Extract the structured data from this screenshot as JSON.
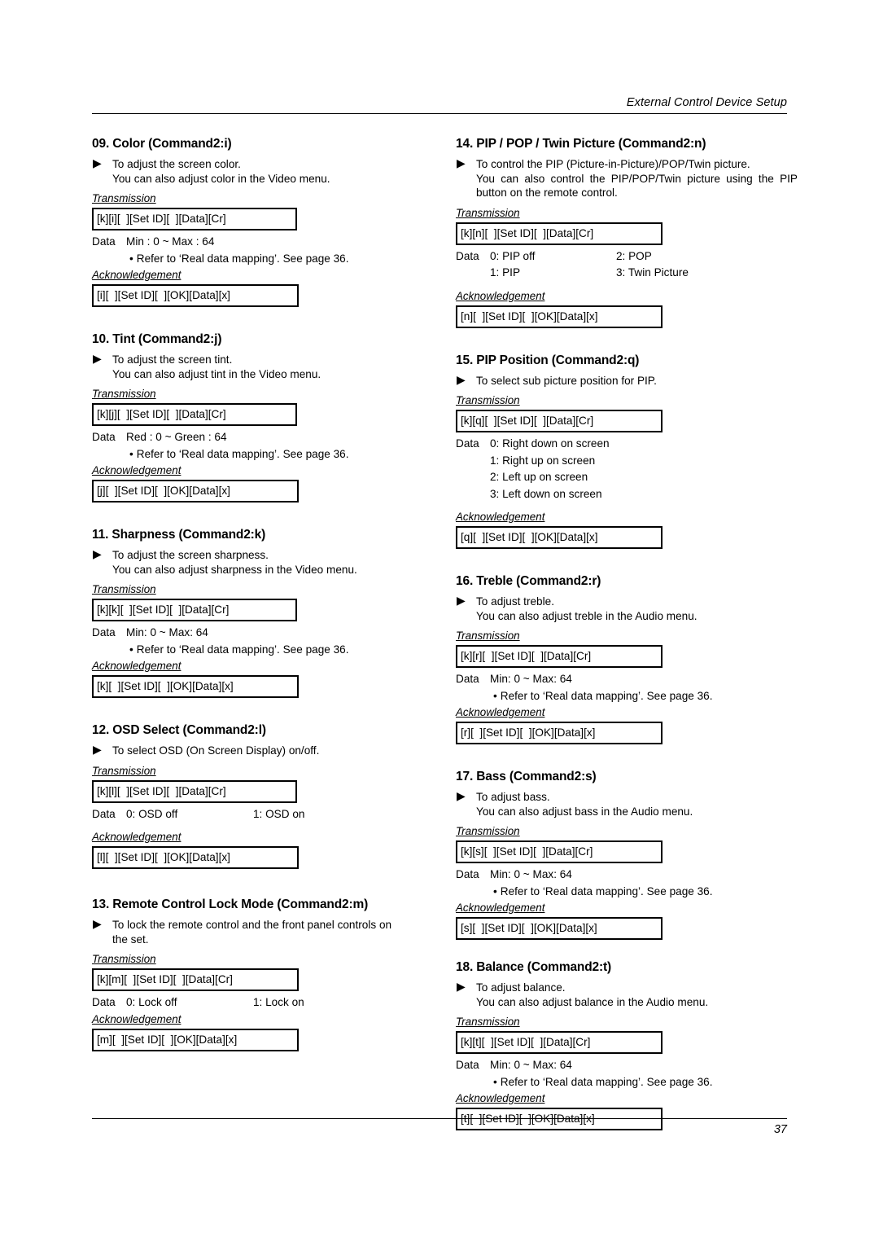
{
  "header": {
    "title": "External Control Device Setup"
  },
  "footer": {
    "page_number": "37"
  },
  "labels": {
    "transmission": "Transmission",
    "acknowledgement": "Acknowledgement",
    "data": "Data",
    "triangle": "▶",
    "bullet": "•"
  },
  "sections": {
    "s09": {
      "title": "09. Color (Command2:i)",
      "desc1": "To adjust the screen color.",
      "desc2": "You can also adjust color in the Video menu.",
      "transmission": "[k][i][  ][Set ID][  ][Data][Cr]",
      "data_key": "Data",
      "data_value": "Min : 0 ~ Max : 64",
      "refer": "Refer to ‘Real data mapping’. See page 36.",
      "acknowledgement": "[i][  ][Set ID][  ][OK][Data][x]"
    },
    "s10": {
      "title": "10. Tint (Command2:j)",
      "desc1": "To adjust the screen tint.",
      "desc2": "You can also adjust tint in the Video menu.",
      "transmission": "[k][j][  ][Set ID][  ][Data][Cr]",
      "data_key": "Data",
      "data_value": "Red : 0 ~ Green : 64",
      "refer": "Refer to ‘Real data mapping’. See page 36.",
      "acknowledgement": "[j][  ][Set ID][  ][OK][Data][x]"
    },
    "s11": {
      "title": "11. Sharpness (Command2:k)",
      "desc1": "To adjust the screen sharpness.",
      "desc2": "You can also adjust sharpness in the Video menu.",
      "transmission": "[k][k][  ][Set ID][  ][Data][Cr]",
      "data_key": "Data",
      "data_value": "Min: 0 ~ Max: 64",
      "refer": "Refer to ‘Real data mapping’. See page 36.",
      "acknowledgement": "[k][  ][Set ID][  ][OK][Data][x]"
    },
    "s12": {
      "title": "12. OSD Select (Command2:l)",
      "desc1": "To select OSD (On Screen Display) on/off.",
      "transmission": "[k][l][  ][Set ID][  ][Data][Cr]",
      "data_key": "Data",
      "data_value": "0: OSD off",
      "data_value2": "1: OSD on",
      "acknowledgement": "[l][  ][Set ID][  ][OK][Data][x]"
    },
    "s13": {
      "title": "13. Remote Control Lock Mode (Command2:m)",
      "desc1": "To lock the remote control and the front panel controls on",
      "desc2": "the set.",
      "transmission": "[k][m][  ][Set ID][  ][Data][Cr]",
      "data_key": "Data",
      "data_value": "0: Lock off",
      "data_value2": "1: Lock on",
      "acknowledgement": "[m][  ][Set ID][  ][OK][Data][x]"
    },
    "s14": {
      "title": "14. PIP / POP / Twin Picture (Command2:n)",
      "desc1": "To control the PIP (Picture-in-Picture)/POP/Twin picture.",
      "desc2": "You can also control the PIP/POP/Twin picture using the PIP button on the remote control.",
      "transmission": "[k][n][  ][Set ID][  ][Data][Cr]",
      "data_key": "Data",
      "data_value": "0: PIP off",
      "data_value2": "2: POP",
      "data_value3": "1: PIP",
      "data_value4": "3: Twin Picture",
      "acknowledgement": "[n][  ][Set ID][  ][OK][Data][x]"
    },
    "s15": {
      "title": "15. PIP Position (Command2:q)",
      "desc1": "To select sub picture position for PIP.",
      "transmission": "[k][q][  ][Set ID][  ][Data][Cr]",
      "data_key": "Data",
      "data_value": "0: Right down on screen",
      "data_value2": "1: Right up on screen",
      "data_value3": "2: Left up on screen",
      "data_value4": "3: Left down on screen",
      "acknowledgement": "[q][  ][Set ID][  ][OK][Data][x]"
    },
    "s16": {
      "title": "16. Treble (Command2:r)",
      "desc1": "To adjust treble.",
      "desc2": "You can also adjust treble in the Audio menu.",
      "transmission": "[k][r][  ][Set ID][  ][Data][Cr]",
      "data_key": "Data",
      "data_value": "Min: 0 ~ Max: 64",
      "refer": "Refer to ‘Real data mapping’. See page 36.",
      "acknowledgement": "[r][  ][Set ID][  ][OK][Data][x]"
    },
    "s17": {
      "title": "17. Bass (Command2:s)",
      "desc1": "To adjust bass.",
      "desc2": "You can also adjust bass in the Audio menu.",
      "transmission": "[k][s][  ][Set ID][  ][Data][Cr]",
      "data_key": "Data",
      "data_value": "Min: 0 ~ Max: 64",
      "refer": "Refer to ‘Real data mapping’. See page 36.",
      "acknowledgement": "[s][  ][Set ID][  ][OK][Data][x]"
    },
    "s18": {
      "title": "18. Balance (Command2:t)",
      "desc1": "To adjust balance.",
      "desc2": "You can also adjust balance in the Audio menu.",
      "transmission": "[k][t][  ][Set ID][  ][Data][Cr]",
      "data_key": "Data",
      "data_value": "Min: 0 ~ Max: 64",
      "refer": "Refer to ‘Real data mapping’. See page 36.",
      "acknowledgement": "[t][  ][Set ID][  ][OK][Data][x]"
    }
  }
}
